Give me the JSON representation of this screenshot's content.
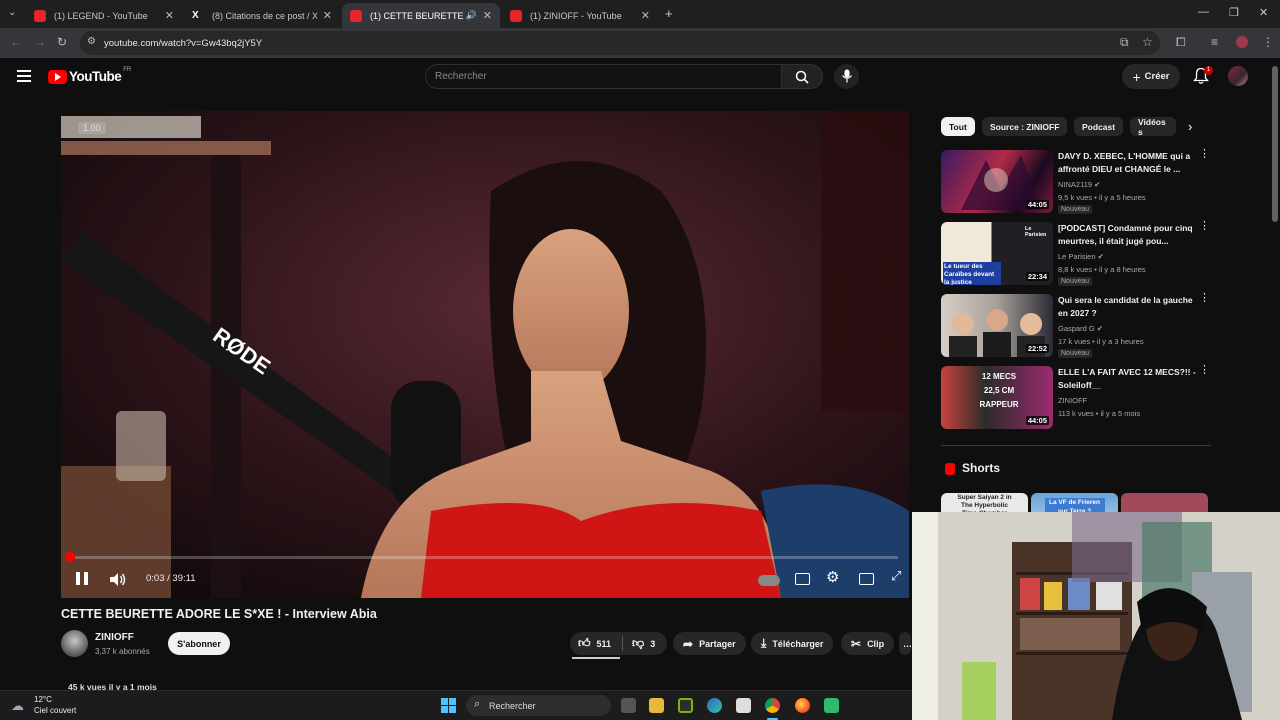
{
  "browser": {
    "tabs": [
      {
        "title": "(1) LEGEND - YouTube",
        "favicon": "youtube-icon"
      },
      {
        "title": "(8) Citations de ce post / X",
        "favicon": "x-icon"
      },
      {
        "title": "(1) CETTE BEURETTE ADORE",
        "favicon": "youtube-icon",
        "active": true
      },
      {
        "title": "(1) ZINIOFF - YouTube",
        "favicon": "youtube-icon"
      }
    ],
    "url": "youtube.com/watch?v=Gw43bq2jY5Y"
  },
  "header": {
    "logo_text": "YouTube",
    "logo_country": "FR",
    "search_placeholder": "Rechercher",
    "create_label": "Créer",
    "notification_count": "1"
  },
  "player": {
    "speed_overlay": "1.00",
    "brand_text": "RØDE",
    "time_label": "0:03 / 39:11",
    "progress_fraction": 0.0013
  },
  "video": {
    "title": "CETTE BEURETTE ADORE LE S*XE ! - Interview Abia",
    "channel": "ZINIOFF",
    "subscribers": "3,37 k abonnés",
    "subscribe_label": "S'abonner",
    "likes": "511",
    "dislikes": "3",
    "share_label": "Partager",
    "download_label": "Télécharger",
    "clip_label": "Clip",
    "meta": "45 k vues  il y a 1 mois"
  },
  "chips": [
    "Tout",
    "Source : ZINIOFF",
    "Podcast",
    "Vidéos s"
  ],
  "recommendations": [
    {
      "title": "DAVY D. XEBEC, L'HOMME qui a affronté DIEU et CHANGÉ le ...",
      "channel": "NINA2119",
      "views": "9,5 k vues • il y a 5 heures",
      "badge": "Nouveau",
      "duration": "44:05",
      "verified": true
    },
    {
      "title": "[PODCAST] Condamné pour cinq meurtres, il était jugé pou...",
      "channel": "Le Parisien",
      "views": "8,8 k vues • il y a 8 heures",
      "badge": "Nouveau",
      "duration": "22:34",
      "verified": true,
      "thumb_text": "Le tueur des Caraïbes devant la justice",
      "thumb_brand": "Le Parisien"
    },
    {
      "title": "Qui sera le candidat de la gauche en 2027 ?",
      "channel": "Gaspard G",
      "views": "17 k vues • il y a 3 heures",
      "badge": "Nouveau",
      "duration": "22:52",
      "verified": true
    },
    {
      "title": "ELLE L'A FAIT AVEC 12 MECS?!! - Soleiloff__",
      "channel": "ZINIOFF",
      "views": "113 k vues • il y a 5 mois",
      "badge": "",
      "duration": "44:05",
      "verified": false,
      "thumb_text": "12 MECS 22,5 CM RAPPEUR"
    }
  ],
  "shorts": {
    "title": "Shorts",
    "items": [
      "Super Saiyan 2 in The Hyperbolic Time Chamber",
      "La VF de Frieren sur Terre ?",
      ""
    ]
  },
  "taskbar": {
    "temperature": "12°C",
    "weather": "Ciel couvert",
    "search_label": "Rechercher"
  }
}
